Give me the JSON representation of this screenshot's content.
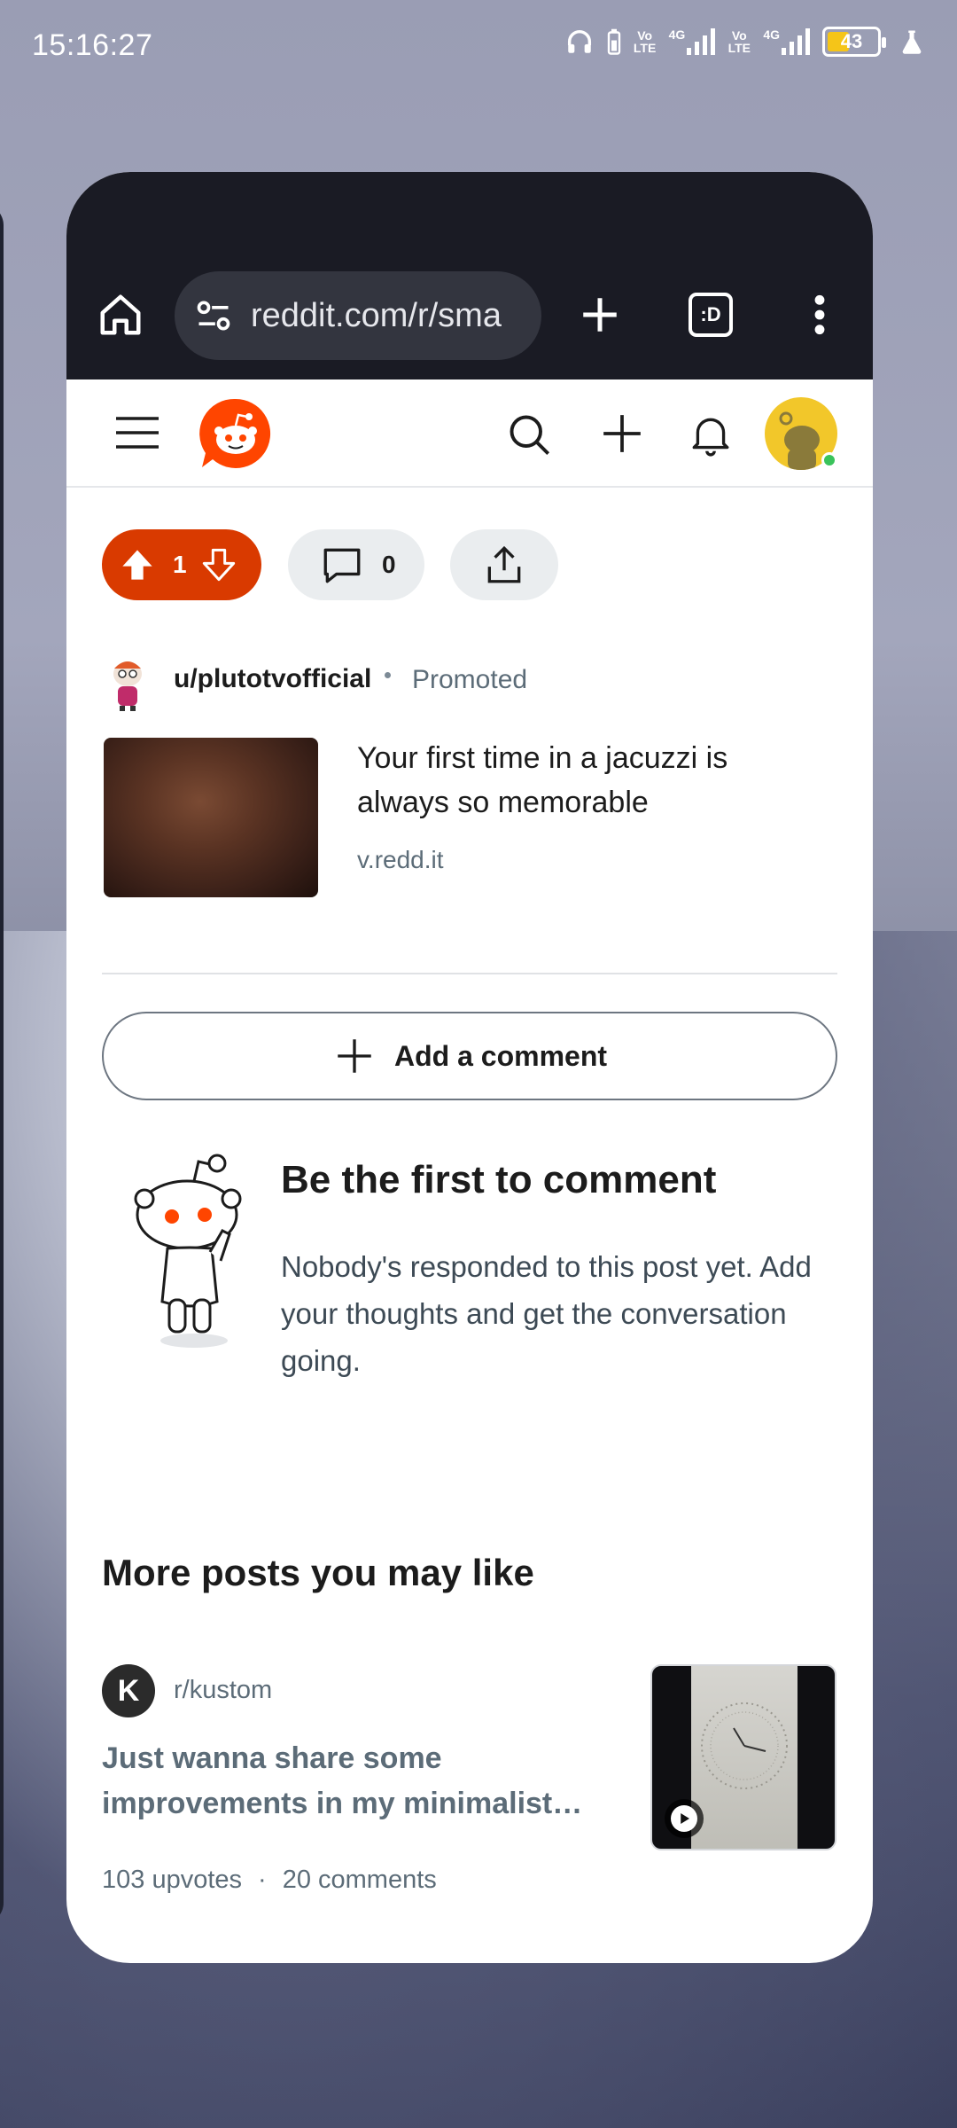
{
  "status_bar": {
    "time": "15:16:27",
    "network_1": "4G",
    "network_2": "4G",
    "volte_1": "Vo LTE",
    "volte_2": "Vo LTE",
    "battery_level": "43",
    "battery_color": "#f5c518"
  },
  "browser": {
    "url": "reddit.com/r/sma",
    "tab_switcher_label": ":D",
    "icons": [
      "home-icon",
      "tune-icon",
      "new-tab-icon",
      "tab-switcher-icon",
      "more-vert-icon"
    ]
  },
  "reddit_header": {
    "icons": [
      "hamburger-menu-icon",
      "reddit-logo",
      "search-icon",
      "create-post-icon",
      "notifications-bell-icon",
      "user-avatar"
    ],
    "brand_color": "#ff4500"
  },
  "actions": {
    "vote_count": "1",
    "comment_count": "0",
    "vote_color": "#d93a00"
  },
  "promoted_post": {
    "username": "u/plutotvofficial",
    "separator": "•",
    "promoted_label": "Promoted",
    "title": "Your first time in a jacuzzi is always so memorable",
    "domain": "v.redd.it"
  },
  "comment_box": {
    "add_comment_label": "Add a comment"
  },
  "empty_state": {
    "title": "Be the first to comment",
    "body": "Nobody's responded to this post yet. Add your thoughts and get the conversation going."
  },
  "more_posts": {
    "heading": "More posts you may like",
    "items": [
      {
        "subreddit_icon_letter": "K",
        "subreddit": "r/kustom",
        "title": "Just wanna share some improvements in my minimalist…",
        "upvotes": "103 upvotes",
        "separator": "·",
        "comments": "20 comments"
      }
    ]
  }
}
